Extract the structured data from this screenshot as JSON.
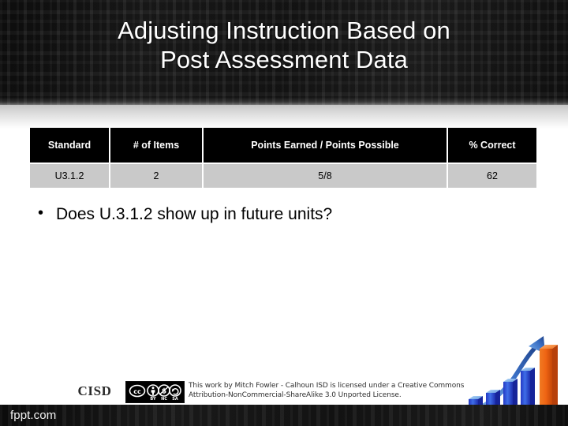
{
  "slide": {
    "title": "Adjusting Instruction Based on\nPost Assessment Data"
  },
  "table": {
    "headers": [
      "Standard",
      "# of Items",
      "Points Earned / Points Possible",
      "% Correct"
    ],
    "rows": [
      [
        "U3.1.2",
        "2",
        "5/8",
        "62"
      ]
    ]
  },
  "bullets": [
    "Does U.3.1.2 show up in future units?"
  ],
  "footer": {
    "logo_text": "CISD",
    "cc_badge": {
      "cc": "cc",
      "marks": [
        "BY",
        "NC",
        "SA"
      ]
    },
    "license_line1": "This work by Mitch Fowler - Calhoun ISD is licensed under a Creative Commons",
    "license_line2": "Attribution-NonCommercial-ShareAlike 3.0 Unported License.",
    "watermark": "fppt.com"
  },
  "theme": {
    "header_bg": "#141414",
    "table_header_bg": "#000000",
    "table_row_bg": "#c9c9c9",
    "text_on_dark": "#ffffff",
    "bar_blue": "#2b4fd6",
    "bar_blue_light": "#7fb3ef",
    "bar_orange": "#ef6413",
    "arrow_blue": "#3a6fc4"
  }
}
